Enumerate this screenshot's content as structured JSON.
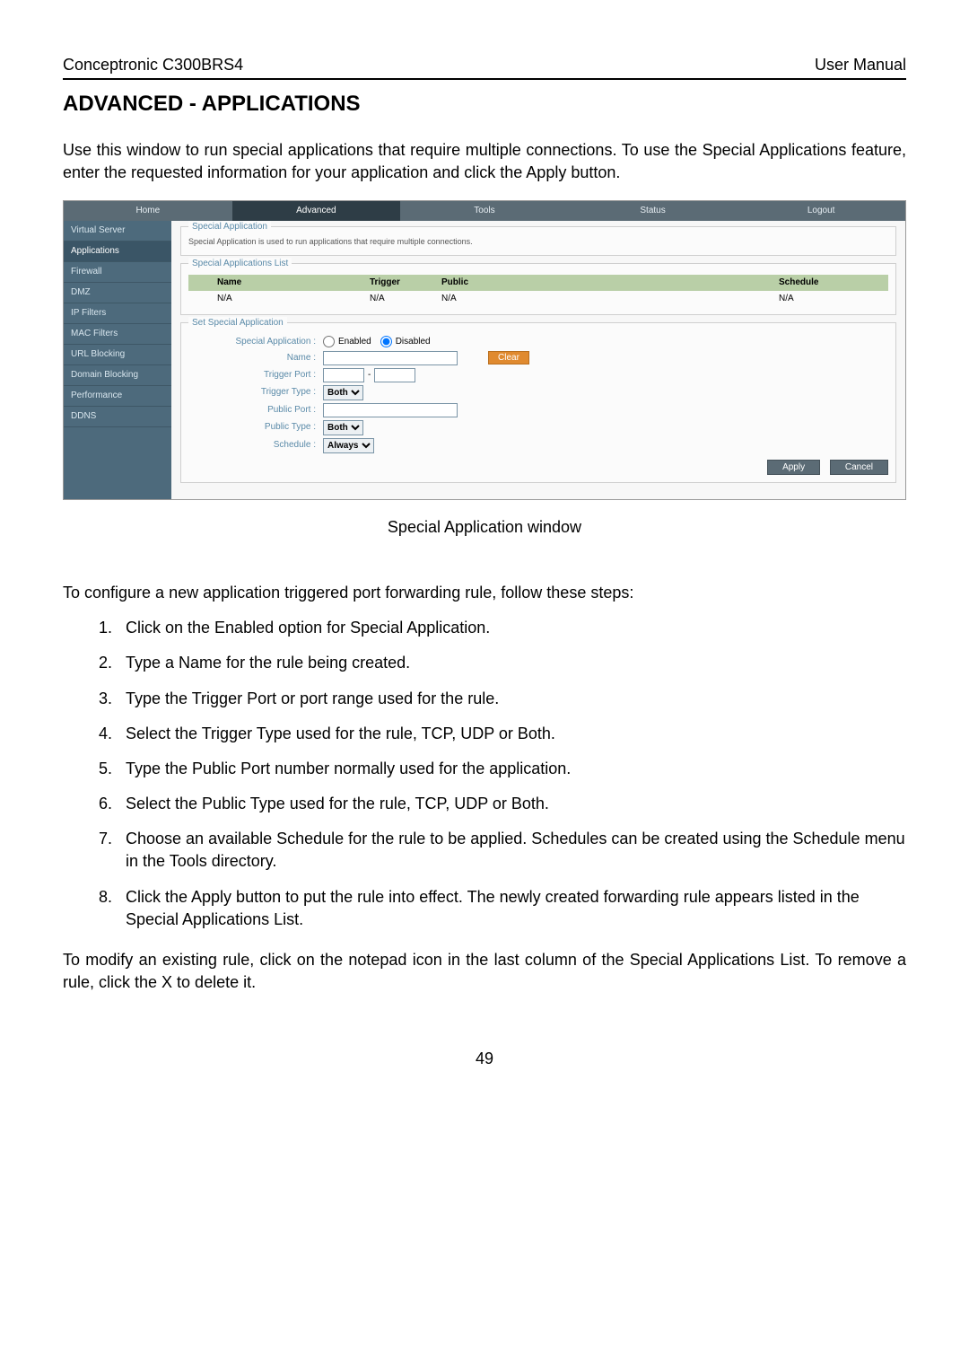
{
  "header": {
    "product": "Conceptronic C300BRS4",
    "doc_label": "User Manual"
  },
  "title": "ADVANCED - APPLICATIONS",
  "intro": "Use this window to run special applications that require multiple connections. To use the Special Applications feature, enter the requested information for your application and click the Apply button.",
  "router": {
    "topnav": [
      "Home",
      "Advanced",
      "Tools",
      "Status",
      "Logout"
    ],
    "active_tab": "Advanced",
    "sidebar": [
      "Virtual Server",
      "Applications",
      "Firewall",
      "DMZ",
      "IP Filters",
      "MAC Filters",
      "URL Blocking",
      "Domain Blocking",
      "Performance",
      "DDNS"
    ],
    "active_side": "Applications",
    "section1": {
      "legend": "Special Application",
      "desc": "Special Application is used to run applications that require multiple connections."
    },
    "list": {
      "legend": "Special Applications List",
      "headers": {
        "name": "Name",
        "trigger": "Trigger",
        "public": "Public",
        "schedule": "Schedule"
      },
      "row": {
        "name": "N/A",
        "trigger": "N/A",
        "public": "N/A",
        "schedule": "N/A"
      }
    },
    "form": {
      "legend": "Set Special Application",
      "labels": {
        "special": "Special Application :",
        "name": "Name :",
        "trigger_port": "Trigger Port :",
        "trigger_type": "Trigger Type :",
        "public_port": "Public Port :",
        "public_type": "Public Type :",
        "schedule": "Schedule :"
      },
      "enabled_label": "Enabled",
      "disabled_label": "Disabled",
      "trigger_type_value": "Both",
      "public_type_value": "Both",
      "schedule_value": "Always",
      "clear": "Clear",
      "apply": "Apply",
      "cancel": "Cancel"
    }
  },
  "caption": "Special Application window",
  "instructions_intro": "To configure a new application triggered port forwarding rule, follow these steps:",
  "steps": [
    "Click on the Enabled option for Special Application.",
    "Type a Name for the rule being created.",
    "Type the Trigger Port or port range used for the rule.",
    "Select the Trigger Type used for the rule, TCP, UDP or Both.",
    "Type the Public Port number normally used for the application.",
    "Select the Public Type used for the rule, TCP, UDP or Both.",
    "Choose an available Schedule for the rule to be applied. Schedules can be created using the Schedule menu in the Tools directory.",
    "Click the Apply button to put the rule into effect. The newly created forwarding rule appears listed in the Special Applications List."
  ],
  "outro": "To modify an existing rule, click on the notepad icon in the last column of the Special Applications List. To remove a rule, click the X to delete it.",
  "page_number": "49"
}
